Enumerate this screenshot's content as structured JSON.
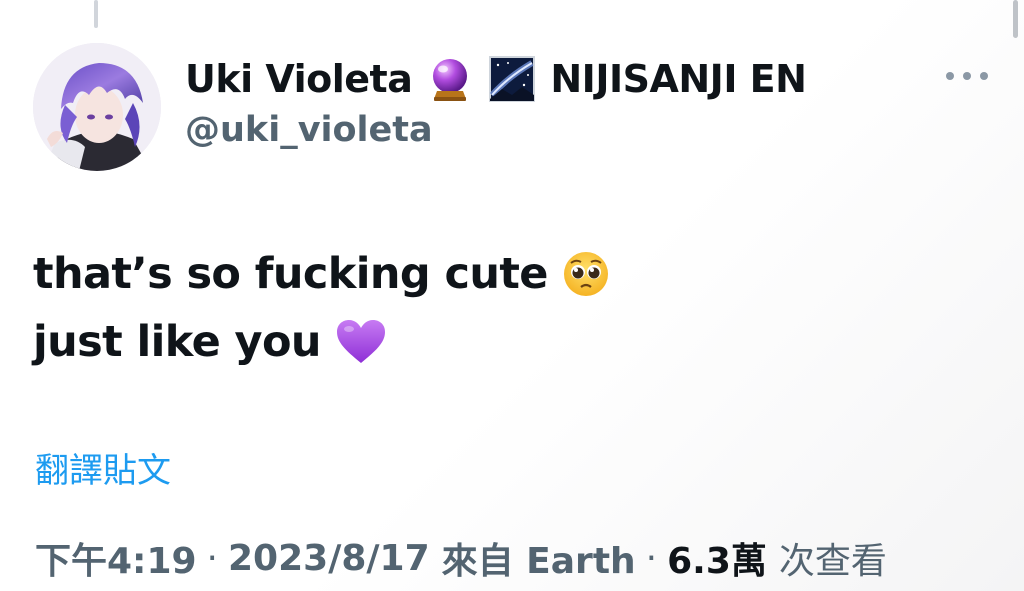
{
  "author": {
    "display_name": "Uki Violeta",
    "name_suffix": "NIJISANJI EN",
    "handle": "@uki_violeta",
    "emojis": [
      "crystal-ball-icon",
      "milky-way-icon"
    ]
  },
  "tweet": {
    "line1": "that’s so fucking cute",
    "line2": "just like you",
    "line1_emoji": "pleading-face-icon",
    "line2_emoji": "purple-heart-icon"
  },
  "translate_label": "翻譯貼文",
  "meta": {
    "time": "下午4:19",
    "date": "2023/8/17",
    "source": "來自 Earth",
    "separator": "·",
    "views_count": "6.3萬",
    "views_label": "次查看"
  },
  "colors": {
    "text_primary": "#0f1419",
    "text_secondary": "#536471",
    "link": "#1d9bf0",
    "accent_purple": "#9b59d6"
  }
}
